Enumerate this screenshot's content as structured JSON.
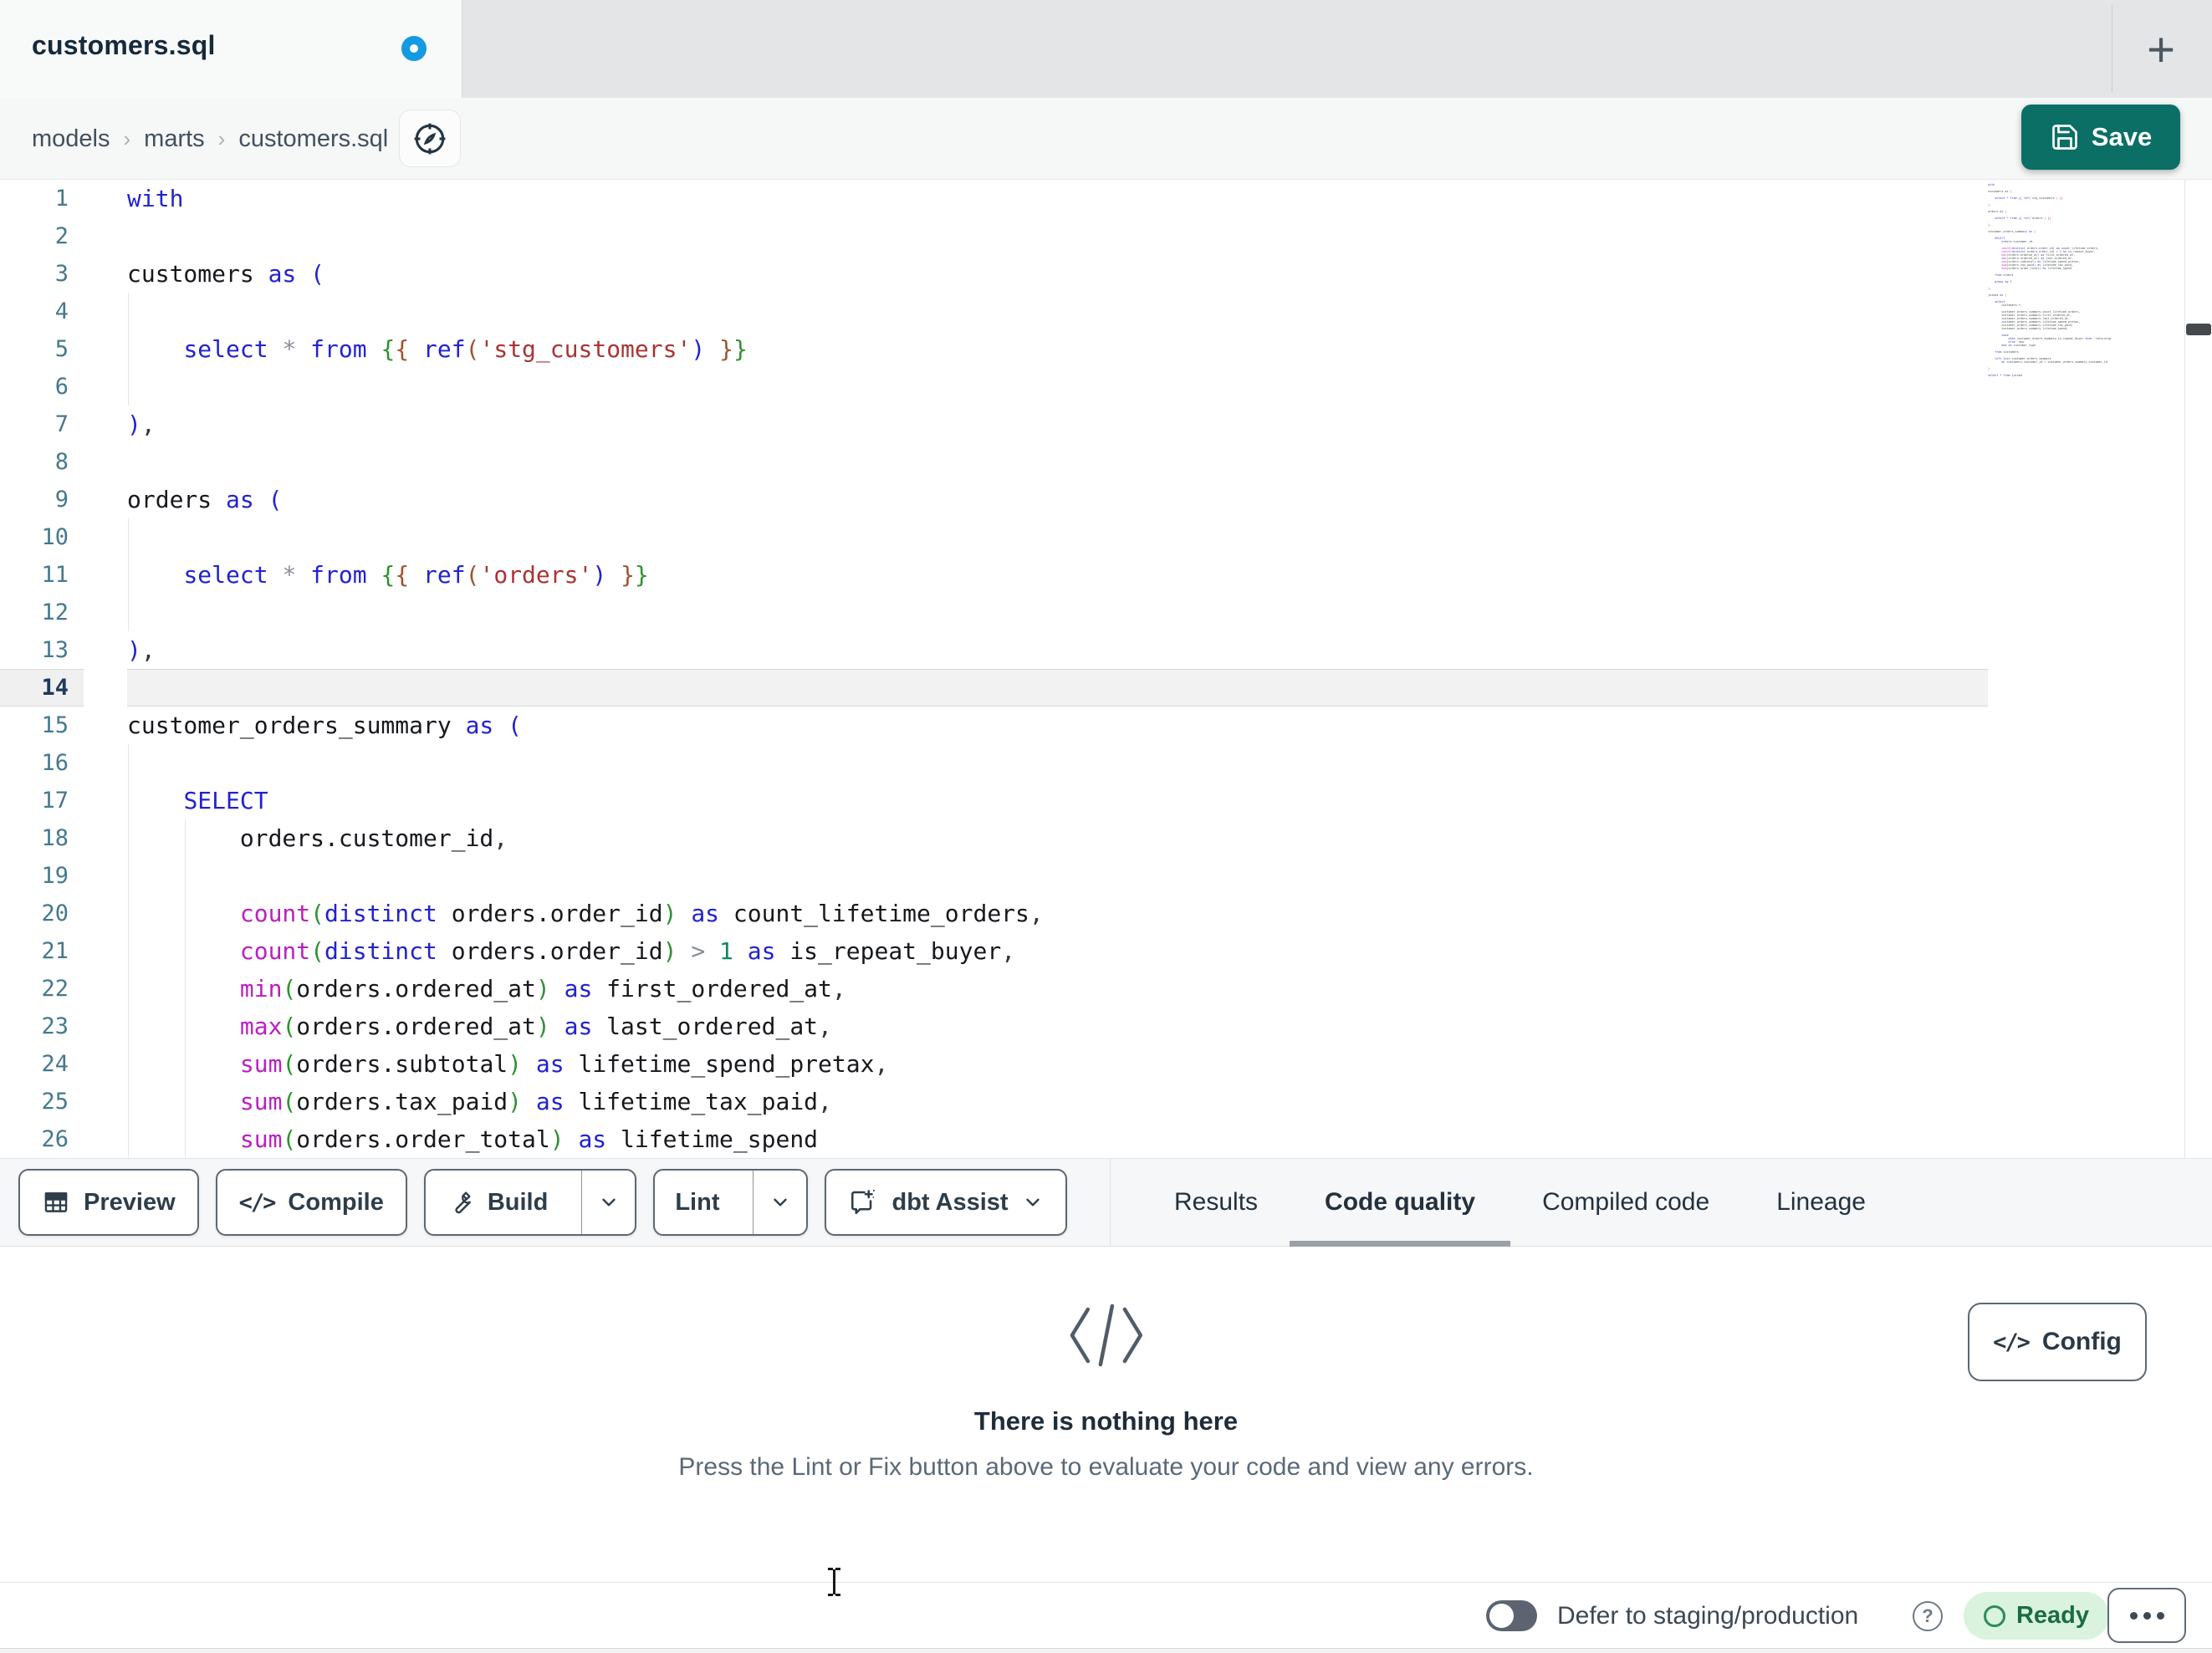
{
  "window": {
    "tab_title": "customers.sql",
    "new_tab_label": "+",
    "unsaved_indicator": true
  },
  "breadcrumb": {
    "items": [
      "models",
      "marts",
      "customers.sql"
    ],
    "separator": "›"
  },
  "header": {
    "save_label": "Save"
  },
  "editor": {
    "active_line": 14,
    "lines": [
      {
        "n": 1,
        "tokens": [
          [
            "kw",
            "with"
          ]
        ]
      },
      {
        "n": 2,
        "tokens": []
      },
      {
        "n": 3,
        "tokens": [
          [
            "id",
            "customers "
          ],
          [
            "kw",
            "as"
          ],
          [
            "id",
            " "
          ],
          [
            "pk",
            "("
          ]
        ]
      },
      {
        "n": 4,
        "guides": [
          0
        ],
        "tokens": []
      },
      {
        "n": 5,
        "guides": [
          0
        ],
        "tokens": [
          [
            "id",
            "    "
          ],
          [
            "kw",
            "select"
          ],
          [
            "id",
            " "
          ],
          [
            "op",
            "*"
          ],
          [
            "id",
            " "
          ],
          [
            "kw",
            "from"
          ],
          [
            "id",
            " "
          ],
          [
            "pg",
            "{"
          ],
          [
            "pb",
            "{"
          ],
          [
            "id",
            " "
          ],
          [
            "kw",
            "ref"
          ],
          [
            "pb",
            "("
          ],
          [
            "str",
            "'stg_customers'"
          ],
          [
            "pk",
            ")"
          ],
          [
            "id",
            " "
          ],
          [
            "pb",
            "}"
          ],
          [
            "pg",
            "}"
          ]
        ]
      },
      {
        "n": 6,
        "guides": [
          0
        ],
        "tokens": []
      },
      {
        "n": 7,
        "tokens": [
          [
            "pk",
            ")"
          ],
          [
            "pun",
            ","
          ]
        ]
      },
      {
        "n": 8,
        "tokens": []
      },
      {
        "n": 9,
        "tokens": [
          [
            "id",
            "orders "
          ],
          [
            "kw",
            "as"
          ],
          [
            "id",
            " "
          ],
          [
            "pk",
            "("
          ]
        ]
      },
      {
        "n": 10,
        "guides": [
          0
        ],
        "tokens": []
      },
      {
        "n": 11,
        "guides": [
          0
        ],
        "tokens": [
          [
            "id",
            "    "
          ],
          [
            "kw",
            "select"
          ],
          [
            "id",
            " "
          ],
          [
            "op",
            "*"
          ],
          [
            "id",
            " "
          ],
          [
            "kw",
            "from"
          ],
          [
            "id",
            " "
          ],
          [
            "pg",
            "{"
          ],
          [
            "pb",
            "{"
          ],
          [
            "id",
            " "
          ],
          [
            "kw",
            "ref"
          ],
          [
            "pb",
            "("
          ],
          [
            "str",
            "'orders'"
          ],
          [
            "pk",
            ")"
          ],
          [
            "id",
            " "
          ],
          [
            "pb",
            "}"
          ],
          [
            "pg",
            "}"
          ]
        ]
      },
      {
        "n": 12,
        "guides": [
          0
        ],
        "tokens": []
      },
      {
        "n": 13,
        "tokens": [
          [
            "pk",
            ")"
          ],
          [
            "pun",
            ","
          ]
        ]
      },
      {
        "n": 14,
        "tokens": []
      },
      {
        "n": 15,
        "tokens": [
          [
            "id",
            "customer_orders_summary "
          ],
          [
            "kw",
            "as"
          ],
          [
            "id",
            " "
          ],
          [
            "pk",
            "("
          ]
        ]
      },
      {
        "n": 16,
        "guides": [
          0
        ],
        "tokens": []
      },
      {
        "n": 17,
        "guides": [
          0
        ],
        "tokens": [
          [
            "id",
            "    "
          ],
          [
            "kw",
            "SELECT"
          ]
        ]
      },
      {
        "n": 18,
        "guides": [
          0,
          1
        ],
        "tokens": [
          [
            "id",
            "        orders.customer_id"
          ],
          [
            "pun",
            ","
          ]
        ]
      },
      {
        "n": 19,
        "guides": [
          0,
          1
        ],
        "tokens": []
      },
      {
        "n": 20,
        "guides": [
          0,
          1
        ],
        "tokens": [
          [
            "id",
            "        "
          ],
          [
            "fn",
            "count"
          ],
          [
            "pg",
            "("
          ],
          [
            "kw",
            "distinct"
          ],
          [
            "id",
            " orders.order_id"
          ],
          [
            "pg",
            ")"
          ],
          [
            "id",
            " "
          ],
          [
            "kw",
            "as"
          ],
          [
            "id",
            " count_lifetime_orders"
          ],
          [
            "pun",
            ","
          ]
        ]
      },
      {
        "n": 21,
        "guides": [
          0,
          1
        ],
        "tokens": [
          [
            "id",
            "        "
          ],
          [
            "fn",
            "count"
          ],
          [
            "pg",
            "("
          ],
          [
            "kw",
            "distinct"
          ],
          [
            "id",
            " orders.order_id"
          ],
          [
            "pg",
            ")"
          ],
          [
            "id",
            " "
          ],
          [
            "op",
            ">"
          ],
          [
            "id",
            " "
          ],
          [
            "num",
            "1"
          ],
          [
            "id",
            " "
          ],
          [
            "kw",
            "as"
          ],
          [
            "id",
            " is_repeat_buyer"
          ],
          [
            "pun",
            ","
          ]
        ]
      },
      {
        "n": 22,
        "guides": [
          0,
          1
        ],
        "tokens": [
          [
            "id",
            "        "
          ],
          [
            "fn",
            "min"
          ],
          [
            "pg",
            "("
          ],
          [
            "id",
            "orders.ordered_at"
          ],
          [
            "pg",
            ")"
          ],
          [
            "id",
            " "
          ],
          [
            "kw",
            "as"
          ],
          [
            "id",
            " first_ordered_at"
          ],
          [
            "pun",
            ","
          ]
        ]
      },
      {
        "n": 23,
        "guides": [
          0,
          1
        ],
        "tokens": [
          [
            "id",
            "        "
          ],
          [
            "fn",
            "max"
          ],
          [
            "pg",
            "("
          ],
          [
            "id",
            "orders.ordered_at"
          ],
          [
            "pg",
            ")"
          ],
          [
            "id",
            " "
          ],
          [
            "kw",
            "as"
          ],
          [
            "id",
            " last_ordered_at"
          ],
          [
            "pun",
            ","
          ]
        ]
      },
      {
        "n": 24,
        "guides": [
          0,
          1
        ],
        "tokens": [
          [
            "id",
            "        "
          ],
          [
            "fn",
            "sum"
          ],
          [
            "pg",
            "("
          ],
          [
            "id",
            "orders.subtotal"
          ],
          [
            "pg",
            ")"
          ],
          [
            "id",
            " "
          ],
          [
            "kw",
            "as"
          ],
          [
            "id",
            " lifetime_spend_pretax"
          ],
          [
            "pun",
            ","
          ]
        ]
      },
      {
        "n": 25,
        "guides": [
          0,
          1
        ],
        "tokens": [
          [
            "id",
            "        "
          ],
          [
            "fn",
            "sum"
          ],
          [
            "pg",
            "("
          ],
          [
            "id",
            "orders.tax_paid"
          ],
          [
            "pg",
            ")"
          ],
          [
            "id",
            " "
          ],
          [
            "kw",
            "as"
          ],
          [
            "id",
            " lifetime_tax_paid"
          ],
          [
            "pun",
            ","
          ]
        ]
      },
      {
        "n": 26,
        "guides": [
          0,
          1
        ],
        "tokens": [
          [
            "id",
            "        "
          ],
          [
            "fn",
            "sum"
          ],
          [
            "pg",
            "("
          ],
          [
            "id",
            "orders.order_total"
          ],
          [
            "pg",
            ")"
          ],
          [
            "id",
            " "
          ],
          [
            "kw",
            "as"
          ],
          [
            "id",
            " lifetime_spend"
          ]
        ]
      }
    ]
  },
  "minimap": {
    "lines": [
      "with",
      "",
      "customers as (",
      "",
      "    select * from {{ ref('stg_customers') }}",
      "",
      "),",
      "",
      "orders as (",
      "",
      "    select * from {{ ref('orders') }}",
      "",
      "),",
      "",
      "customer_orders_summary as (",
      "",
      "    SELECT",
      "        orders.customer_id,",
      "",
      "        count(distinct orders.order_id) as count_lifetime_orders,",
      "        count(distinct orders.order_id) > 1 as is_repeat_buyer,",
      "        min(orders.ordered_at) as first_ordered_at,",
      "        max(orders.ordered_at) as last_ordered_at,",
      "        sum(orders.subtotal) as lifetime_spend_pretax,",
      "        sum(orders.tax_paid) as lifetime_tax_paid,",
      "        sum(orders.order_total) as lifetime_spend",
      "",
      "    from orders",
      "",
      "    group by 1",
      "",
      "),",
      "",
      "joined as (",
      "",
      "    select",
      "        customers.*,",
      "",
      "        customer_orders_summary.count_lifetime_orders,",
      "        customer_orders_summary.first_ordered_at,",
      "        customer_orders_summary.last_ordered_at,",
      "        customer_orders_summary.lifetime_spend_pretax,",
      "        customer_orders_summary.lifetime_tax_paid,",
      "        customer_orders_summary.lifetime_spend,",
      "",
      "        case",
      "            when customer_orders_summary.is_repeat_buyer then 'returning'",
      "            else 'new'",
      "        end as customer_type",
      "",
      "    from customers",
      "",
      "    left join customer_orders_summary",
      "        on customers.customer_id = customer_orders_summary.customer_id",
      "",
      ")",
      "",
      "select * from joined"
    ]
  },
  "toolbar": {
    "preview_label": "Preview",
    "compile_label": "Compile",
    "build_label": "Build",
    "lint_label": "Lint",
    "assist_label": "dbt Assist"
  },
  "tabs": [
    {
      "label": "Results",
      "active": false
    },
    {
      "label": "Code quality",
      "active": true
    },
    {
      "label": "Compiled code",
      "active": false
    },
    {
      "label": "Lineage",
      "active": false
    }
  ],
  "panel": {
    "empty_title": "There is nothing here",
    "empty_subtitle": "Press the Lint or Fix button above to evaluate your code and view any errors.",
    "config_label": "Config"
  },
  "status_bar": {
    "defer_label": "Defer to staging/production",
    "help_glyph": "?",
    "ready_label": "Ready",
    "toggle_state": "off"
  },
  "colors": {
    "accent_teal": "#0b6f66",
    "unsaved_dot_blue": "#149ae1",
    "ready_badge_bg": "#d9f3de",
    "ready_badge_text": "#1c6b45",
    "active_tab_underline": "#99a0a7",
    "syntax_keyword": "#2222cf",
    "syntax_function": "#bb1fbf",
    "syntax_string": "#a93434",
    "syntax_paren_green": "#2e9230",
    "syntax_paren_brown": "#a0522d",
    "syntax_number": "#0e8a63",
    "line_number": "#45798c"
  }
}
